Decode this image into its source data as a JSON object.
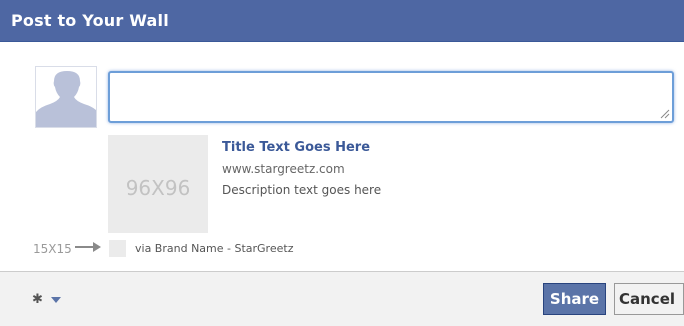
{
  "dialog": {
    "title": "Post to Your Wall",
    "status_input": {
      "value": "",
      "placeholder": ""
    }
  },
  "attachment": {
    "thumbnail_label": "96X96",
    "title": "Title Text Goes Here",
    "url": "www.stargreetz.com",
    "description": "Description text goes here"
  },
  "attribution": {
    "icon_size_label": "15X15",
    "via_text": "via Brand Name - StarGreetz"
  },
  "footer": {
    "share_label": "Share",
    "cancel_label": "Cancel"
  },
  "icons": {
    "avatar": "silhouette-avatar-icon",
    "arrow": "arrow-right-icon",
    "settings": "gear-icon",
    "dropdown": "chevron-down-icon",
    "resize": "resize-grip-icon"
  },
  "colors": {
    "header_bg": "#4e67a3",
    "link": "#3b5998",
    "input_focus": "#6d9ed8",
    "share_bg": "#5b74a8",
    "footer_bg": "#f2f2f2",
    "placeholder_box": "#ebebeb"
  }
}
